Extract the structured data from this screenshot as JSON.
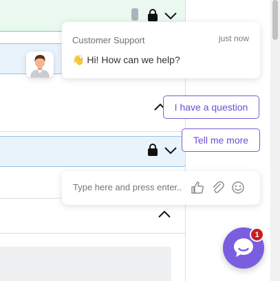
{
  "chat": {
    "sender_name": "Customer Support",
    "timestamp": "just now",
    "message_emoji": "👋",
    "message_text": "Hi! How can we help?",
    "quick_replies": [
      "I have a question",
      "Tell me more"
    ],
    "input_placeholder": "Type here and press enter..",
    "unread_count": "1",
    "accent_color": "#7b5ee0",
    "badge_color": "#c41f26"
  },
  "background": {
    "bar_colors": {
      "green": "#eaf8ef",
      "blue": "#e9f3fc"
    }
  },
  "icons": [
    "lock-icon",
    "chevron-down-icon",
    "chevron-up-icon",
    "thumbs-up-icon",
    "paperclip-icon",
    "smiley-icon",
    "chat-bubble-icon"
  ]
}
